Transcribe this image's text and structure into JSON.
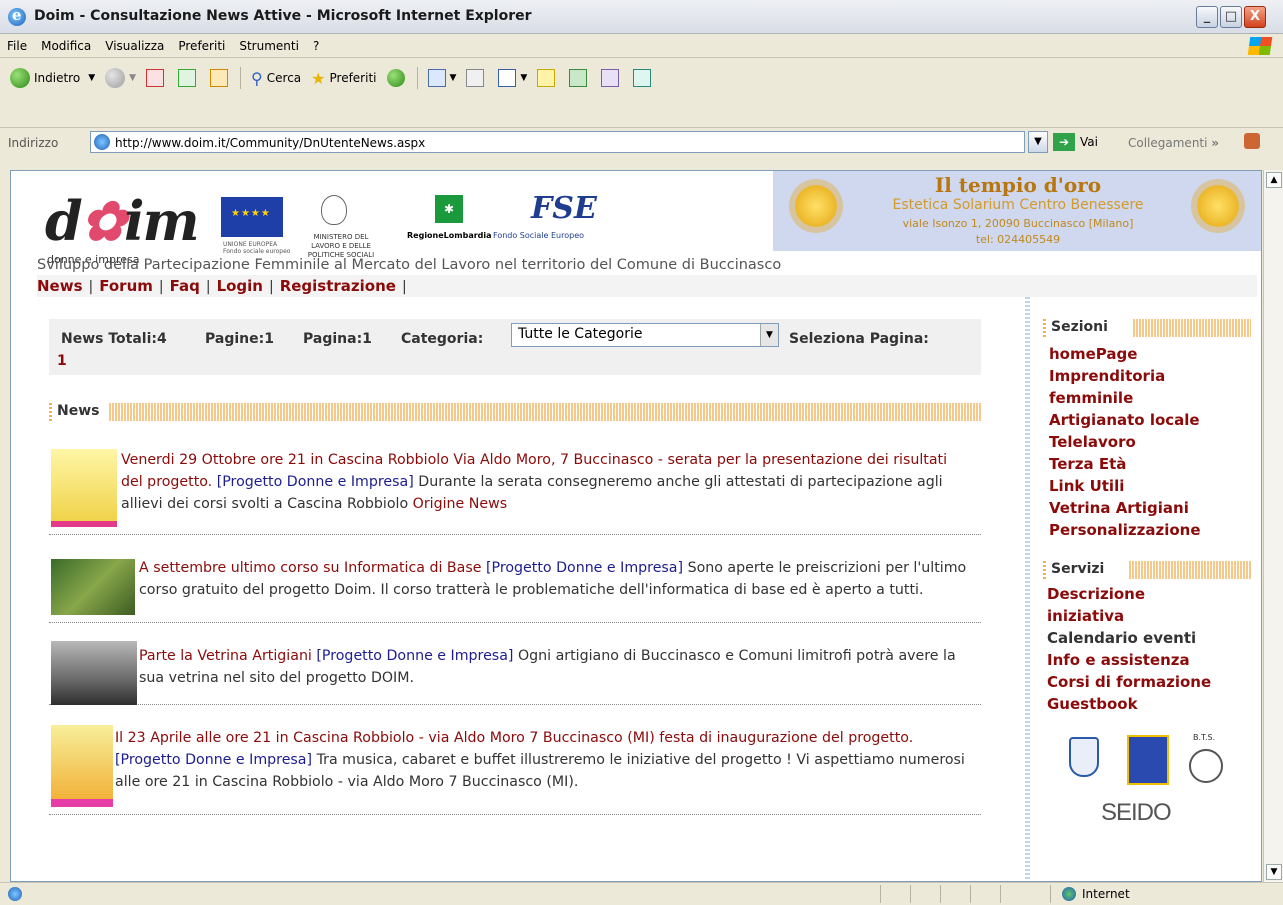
{
  "window": {
    "title": "Doim - Consultazione News Attive - Microsoft Internet Explorer",
    "controls": [
      "_",
      "□",
      "X"
    ]
  },
  "menu": [
    "File",
    "Modifica",
    "Visualizza",
    "Preferiti",
    "Strumenti",
    "?"
  ],
  "toolbar": {
    "back": "Indietro",
    "search": "Cerca",
    "favorites": "Preferiti"
  },
  "address": {
    "label": "Indirizzo",
    "url": "http://www.doim.it/Community/DnUtenteNews.aspx",
    "go": "Vai",
    "links": "Collegamenti",
    "chevron": "»"
  },
  "header": {
    "logo_sub": "donne e impresa",
    "eu_caption": "UNIONE EUROPEA Fondo sociale europeo",
    "ministry": "MINISTERO DEL LAVORO E DELLE POLITICHE SOCIALI",
    "region": "RegioneLombardia",
    "fse": "Fondo Sociale Europeo",
    "banner": {
      "title": "Il tempio d'oro",
      "subtitle": "Estetica Solarium Centro Benessere",
      "address": "viale Isonzo 1, 20090 Buccinasco [Milano]",
      "phone": "tel: 024405549"
    },
    "tagline": "Sviluppo della Partecipazione Femminile al Mercato del Lavoro nel territorio del Comune di Buccinasco"
  },
  "nav": [
    "News",
    "Forum",
    "Faq",
    "Login",
    "Registrazione"
  ],
  "filter": {
    "totals": "News Totali:4",
    "pages": "Pagine:1",
    "page": "Pagina:1",
    "category_label": "Categoria:",
    "category_value": "Tutte le Categorie",
    "select_page": "Seleziona Pagina:",
    "page_link": "1"
  },
  "news_section": "News",
  "news": [
    {
      "title": "Venerdi 29 Ottobre ore 21 in Cascina Robbiolo Via Aldo Moro, 7 Buccinasco - serata per la presentazione dei risultati del progetto.",
      "project": "[Progetto Donne e Impresa]",
      "body": "Durante la serata consegneremo anche gli attestati di partecipazione agli allievi dei corsi svolti a Cascina Robbiolo",
      "origin": "Origine News"
    },
    {
      "title": "A settembre ultimo corso su Informatica di Base",
      "project": "[Progetto Donne e Impresa]",
      "body": "Sono aperte le preiscrizioni per l'ultimo corso gratuito del progetto Doim. Il corso tratterà le problematiche dell'informatica di base ed è aperto a tutti."
    },
    {
      "title": "Parte la Vetrina Artigiani",
      "project": "[Progetto Donne e Impresa]",
      "body": "Ogni artigiano di Buccinasco e Comuni limitrofi potrà avere la sua vetrina nel sito del progetto DOIM."
    },
    {
      "title": "Il 23 Aprile alle ore 21 in Cascina Robbiolo - via Aldo Moro 7 Buccinasco (MI) festa di inaugurazione del progetto.",
      "project": "[Progetto Donne e Impresa]",
      "body": "Tra musica, cabaret e buffet illustreremo le iniziative del progetto ! Vi aspettiamo numerosi alle ore 21 in Cascina Robbiolo - via Aldo Moro 7 Buccinasco (MI)."
    }
  ],
  "sidebar": {
    "sections_title": "Sezioni",
    "sections": [
      "homePage",
      "Imprenditoria femminile",
      "Artigianato locale",
      "Telelavoro",
      "Terza Età",
      "Link Utili",
      "Vetrina Artigiani",
      "Personalizzazione"
    ],
    "services_title": "Servizi",
    "services": [
      "Descrizione iniziativa",
      "Calendario eventi",
      "Info e assistenza",
      "Corsi di formazione",
      "Guestbook"
    ],
    "partner_seido": "SEIDO",
    "partner_bts": "B.T.S."
  },
  "status": {
    "zone": "Internet"
  }
}
